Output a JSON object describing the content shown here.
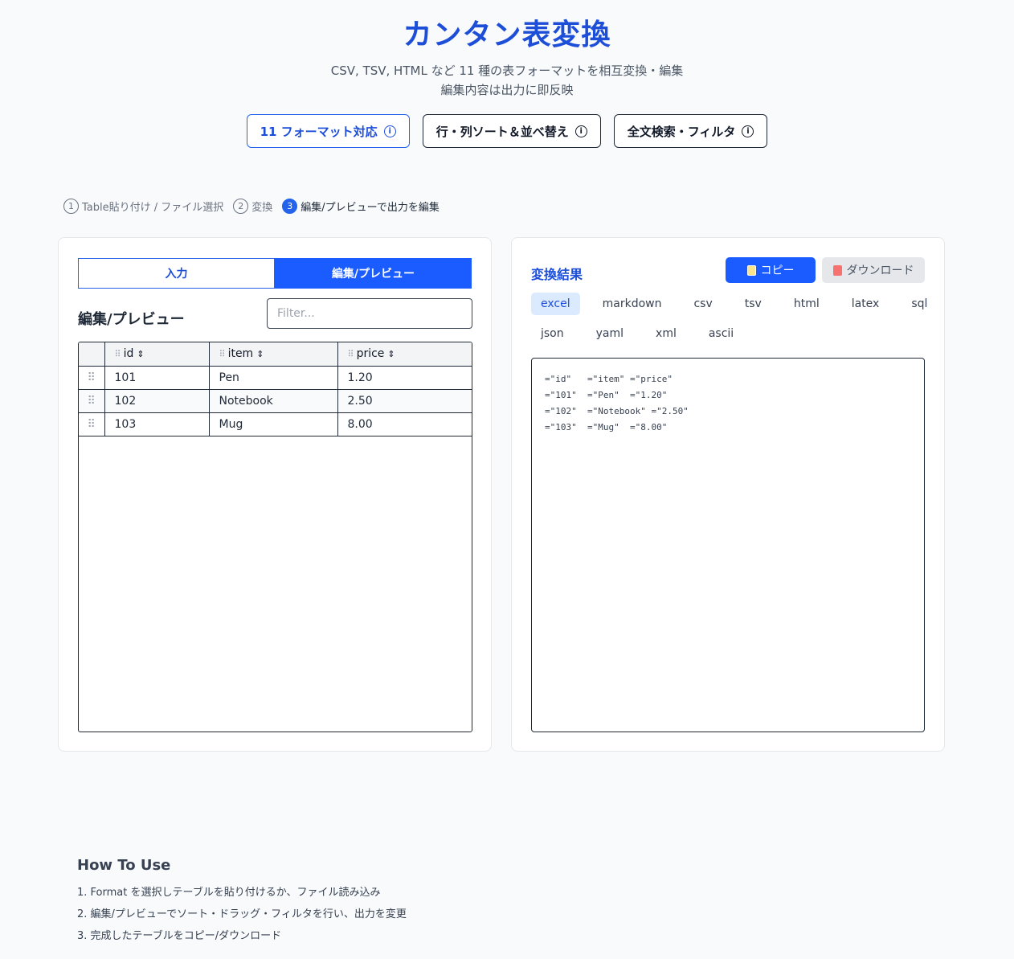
{
  "header": {
    "title": "カンタン表変換",
    "subtitle_line1": "CSV, TSV, HTML など 11 種の表フォーマットを相互変換・編集",
    "subtitle_line2": "編集内容は出力に即反映"
  },
  "features": [
    {
      "label": "11 フォーマット対応",
      "icon": "info-icon"
    },
    {
      "label": "行・列ソート＆並べ替え",
      "icon": "info-icon"
    },
    {
      "label": "全文検索・フィルタ",
      "icon": "info-icon"
    }
  ],
  "steps": [
    {
      "num": "1",
      "label": "Table貼り付け / ファイル選択"
    },
    {
      "num": "2",
      "label": "変換"
    },
    {
      "num": "3",
      "label": "編集/プレビューで出力を編集"
    }
  ],
  "left_panel": {
    "tab_input": "入力",
    "tab_edit": "編集/プレビュー",
    "section_title": "編集/プレビュー",
    "filter_placeholder": "Filter..."
  },
  "table": {
    "columns": [
      "id",
      "item",
      "price"
    ],
    "rows": [
      [
        "101",
        "Pen",
        "1.20"
      ],
      [
        "102",
        "Notebook",
        "2.50"
      ],
      [
        "103",
        "Mug",
        "8.00"
      ]
    ]
  },
  "right_panel": {
    "title": "変換結果",
    "copy_label": "コピー",
    "download_label": "ダウンロード",
    "formats_row1": [
      "excel",
      "markdown",
      "csv",
      "tsv",
      "html",
      "latex",
      "sql"
    ],
    "formats_row2": [
      "json",
      "yaml",
      "xml",
      "ascii"
    ],
    "active_format": "excel",
    "output_lines": [
      "=\"id\"   =\"item\" =\"price\"",
      "=\"101\"  =\"Pen\"  =\"1.20\"",
      "=\"102\"  =\"Notebook\" =\"2.50\"",
      "=\"103\"  =\"Mug\"  =\"8.00\""
    ]
  },
  "howto": {
    "title": "How To Use",
    "items": [
      "1. Format を選択しテーブルを貼り付けるか、ファイル読み込み",
      "2. 編集/プレビューでソート・ドラッグ・フィルタを行い、出力を変更",
      "3. 完成したテーブルをコピー/ダウンロード"
    ]
  },
  "colors": {
    "accent": "#1a5cff",
    "title": "#1d4ed8",
    "background": "#f8fafc"
  }
}
